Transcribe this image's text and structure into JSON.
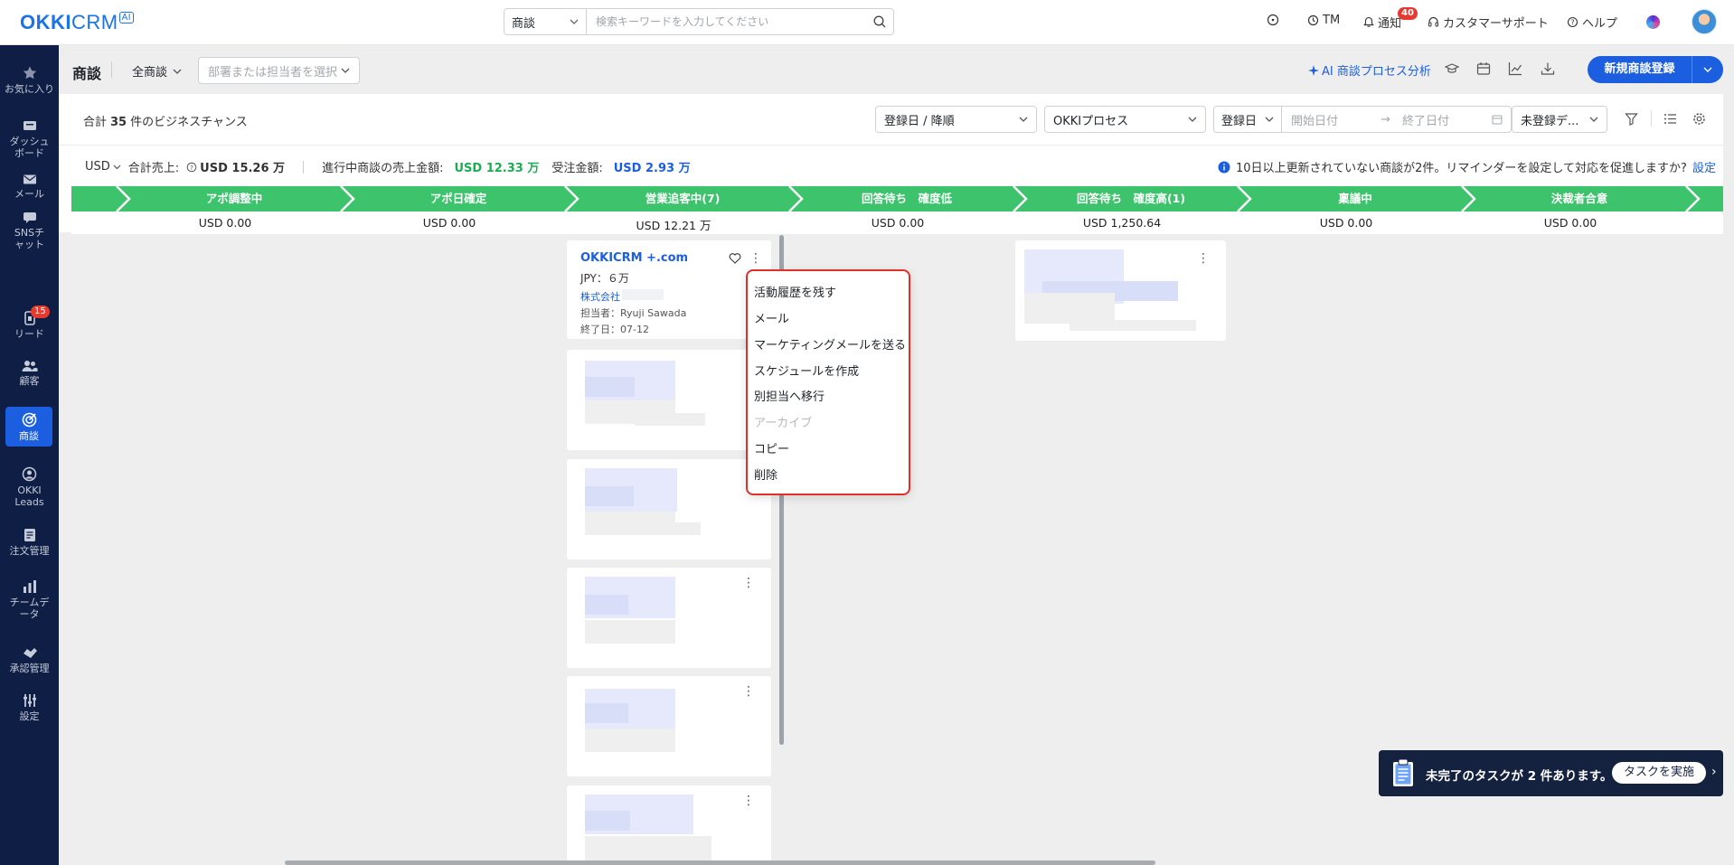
{
  "app": {
    "logo": "OKKICRM",
    "logo_ai": "AI"
  },
  "search": {
    "type_value": "商談",
    "placeholder": "検索キーワードを入力してください"
  },
  "topnav": {
    "tm": "TM",
    "notice_label": "通知",
    "notice_count": "40",
    "support": "カスタマーサポート",
    "help": "ヘルプ"
  },
  "sidebar": {
    "items": [
      {
        "label": "お気に入り",
        "icon": "star-icon"
      },
      {
        "label": "ダッシュボード",
        "icon": "dashboard-icon"
      },
      {
        "label": "メール",
        "icon": "mail-icon"
      },
      {
        "label": "SNSチャット",
        "icon": "chat-icon"
      },
      {
        "label": "リード",
        "icon": "lead-icon",
        "badge": "15"
      },
      {
        "label": "顧客",
        "icon": "customers-icon"
      },
      {
        "label": "商談",
        "icon": "target-icon",
        "active": true
      },
      {
        "label": "OKKI Leads",
        "icon": "okki-leads-icon"
      },
      {
        "label": "注文管理",
        "icon": "order-icon"
      },
      {
        "label": "チームデータ",
        "icon": "bar-chart-icon"
      },
      {
        "label": "承認管理",
        "icon": "approval-icon"
      },
      {
        "label": "設定",
        "icon": "settings-icon"
      }
    ]
  },
  "header": {
    "title": "商談",
    "scope": "全商談",
    "dept_placeholder": "部署または担当者を選択",
    "ai_link": "AI 商談プロセス分析",
    "new_button": "新規商談登録"
  },
  "filters": {
    "total_prefix": "合計",
    "total_count": "35",
    "total_suffix": "件のビジネスチャンス",
    "sort": "登録日 / 降順",
    "process": "OKKIプロセス",
    "date_field": "登録日",
    "start_placeholder": "開始日付",
    "end_placeholder": "終了日付",
    "date_arrow": "→",
    "unregistered": "未登録デ..."
  },
  "stats": {
    "currency": "USD",
    "total_sales_label": "合計売上:",
    "total_sales_value": "USD 15.26 万",
    "in_progress_label": "進行中商談の売上金額:",
    "in_progress_value": "USD 12.33 万",
    "won_label": "受注金額:",
    "won_value": "USD 2.93 万",
    "notice": "10日以上更新されていない商談が2件。リマインダーを設定して対応を促進しますか?",
    "notice_link": "設定"
  },
  "stages": [
    {
      "name": "アポ調整中",
      "amount": "USD 0.00"
    },
    {
      "name": "アポ日確定",
      "amount": "USD 0.00"
    },
    {
      "name": "営業追客中(7)",
      "amount": "USD 12.21 万"
    },
    {
      "name": "回答待ち　確度低",
      "amount": "USD 0.00"
    },
    {
      "name": "回答待ち　確度高(1)",
      "amount": "USD 1,250.64"
    },
    {
      "name": "稟議中",
      "amount": "USD 0.00"
    },
    {
      "name": "決裁者合意",
      "amount": "USD 0.00"
    }
  ],
  "card": {
    "title": "OKKICRM +.com",
    "amount": "JPY：６万",
    "company": "株式会社",
    "owner": "担当者：Ryuji Sawada",
    "end_date": "終了日：07-12"
  },
  "context_menu": {
    "items": [
      {
        "label": "活動履歴を残す",
        "disabled": false
      },
      {
        "label": "メール",
        "disabled": false
      },
      {
        "label": "マーケティングメールを送る",
        "disabled": false
      },
      {
        "label": "スケジュールを作成",
        "disabled": false
      },
      {
        "label": "別担当へ移行",
        "disabled": false
      },
      {
        "label": "アーカイブ",
        "disabled": true
      },
      {
        "label": "コピー",
        "disabled": false
      },
      {
        "label": "削除",
        "disabled": false
      }
    ]
  },
  "toast": {
    "message": "未完了のタスクが 2 件あります。",
    "button": "タスクを実施"
  },
  "colors": {
    "primary": "#1b5fe0",
    "stage_green": "#3cc36b",
    "sidebar_bg": "#0e1e45",
    "highlight_red": "#e0302a"
  }
}
